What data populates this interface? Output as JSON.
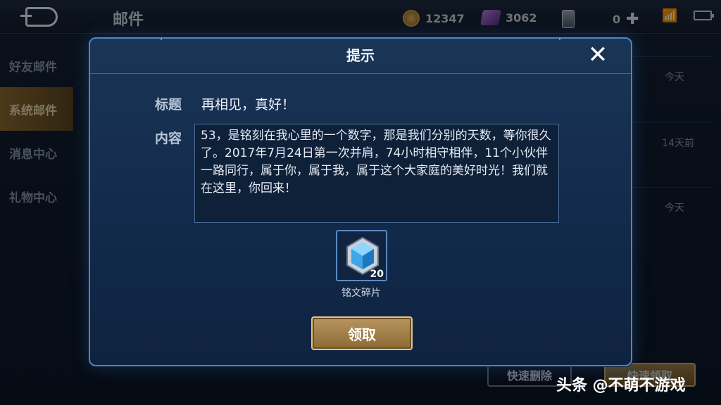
{
  "header": {
    "title": "邮件",
    "gold": "12347",
    "diamonds": "3062",
    "cards": "0"
  },
  "sidebar": {
    "items": [
      {
        "label": "好友邮件"
      },
      {
        "label": "系统邮件"
      },
      {
        "label": "消息中心"
      },
      {
        "label": "礼物中心"
      }
    ]
  },
  "mail_list": {
    "times": [
      "今天",
      "14天前",
      "今天"
    ],
    "quick_delete_label": "快速删除",
    "quick_claim_label": "快速领取"
  },
  "dialog": {
    "title": "提示",
    "subject_label": "标题",
    "subject": "再相见，真好！",
    "content_label": "内容",
    "content": "53，是铭刻在我心里的一个数字，那是我们分别的天数，等你很久了。2017年7月24日第一次并肩，74小时相守相伴，11个小伙伴一路同行，属于你，属于我，属于这个大家庭的美好时光！我们就在这里，你回来！",
    "item_name": "铭文碎片",
    "item_count": "20",
    "claim_label": "领取"
  },
  "watermark": "头条 @不萌不游戏",
  "colors": {
    "accent_blue": "#4d87c0",
    "claim_gold": "#b99660",
    "active_tab": "#8a6a2e"
  }
}
